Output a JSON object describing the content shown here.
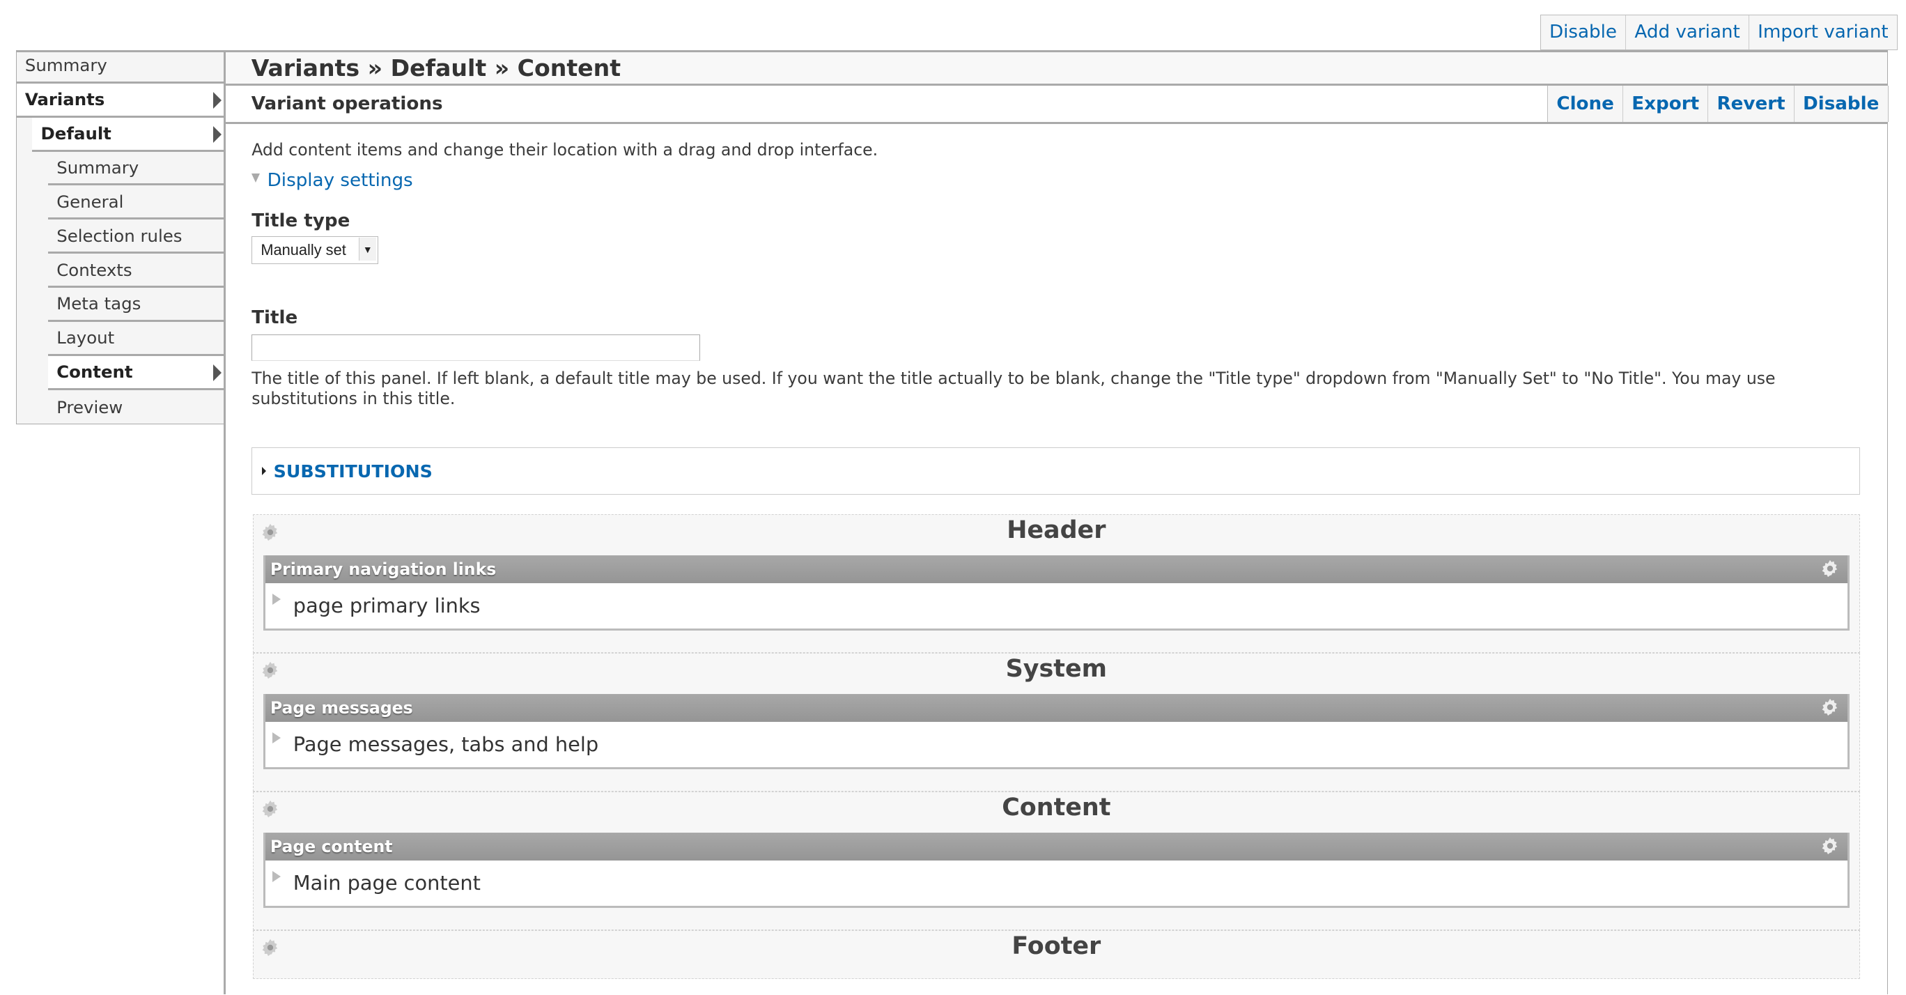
{
  "top_actions": [
    "Disable",
    "Add variant",
    "Import variant"
  ],
  "sidebar": {
    "items": [
      {
        "label": "Summary",
        "level": 0,
        "active": false
      },
      {
        "label": "Variants",
        "level": 0,
        "active": true,
        "expandable": true
      },
      {
        "label": "Default",
        "level": 1,
        "active": true,
        "expandable": true
      },
      {
        "label": "Summary",
        "level": 2,
        "active": false
      },
      {
        "label": "General",
        "level": 2,
        "active": false
      },
      {
        "label": "Selection rules",
        "level": 2,
        "active": false
      },
      {
        "label": "Contexts",
        "level": 2,
        "active": false
      },
      {
        "label": "Meta tags",
        "level": 2,
        "active": false
      },
      {
        "label": "Layout",
        "level": 2,
        "active": false
      },
      {
        "label": "Content",
        "level": 2,
        "active": true,
        "expandable": true
      },
      {
        "label": "Preview",
        "level": 2,
        "active": false
      }
    ]
  },
  "main": {
    "breadcrumb": "Variants » Default » Content",
    "operations_label": "Variant operations",
    "operations": [
      "Clone",
      "Export",
      "Revert",
      "Disable"
    ],
    "intro": "Add content items and change their location with a drag and drop interface.",
    "display_settings": "Display settings",
    "title_type_label": "Title type",
    "title_type_value": "Manually set",
    "title_label": "Title",
    "title_value": "",
    "title_help": "The title of this panel. If left blank, a default title may be used. If you want the title actually to be blank, change the \"Title type\" dropdown from \"Manually Set\" to \"No Title\". You may use substitutions in this title.",
    "substitutions": "SUBSTITUTIONS",
    "regions": [
      {
        "name": "Header",
        "pane": {
          "title": "Primary navigation links",
          "content": "page primary links"
        }
      },
      {
        "name": "System",
        "pane": {
          "title": "Page messages",
          "content": "Page messages, tabs and help"
        }
      },
      {
        "name": "Content",
        "pane": {
          "title": "Page content",
          "content": "Main page content"
        }
      },
      {
        "name": "Footer"
      }
    ]
  },
  "colors": {
    "link": "#0767b0",
    "pane_header": "#9e9e9e"
  }
}
